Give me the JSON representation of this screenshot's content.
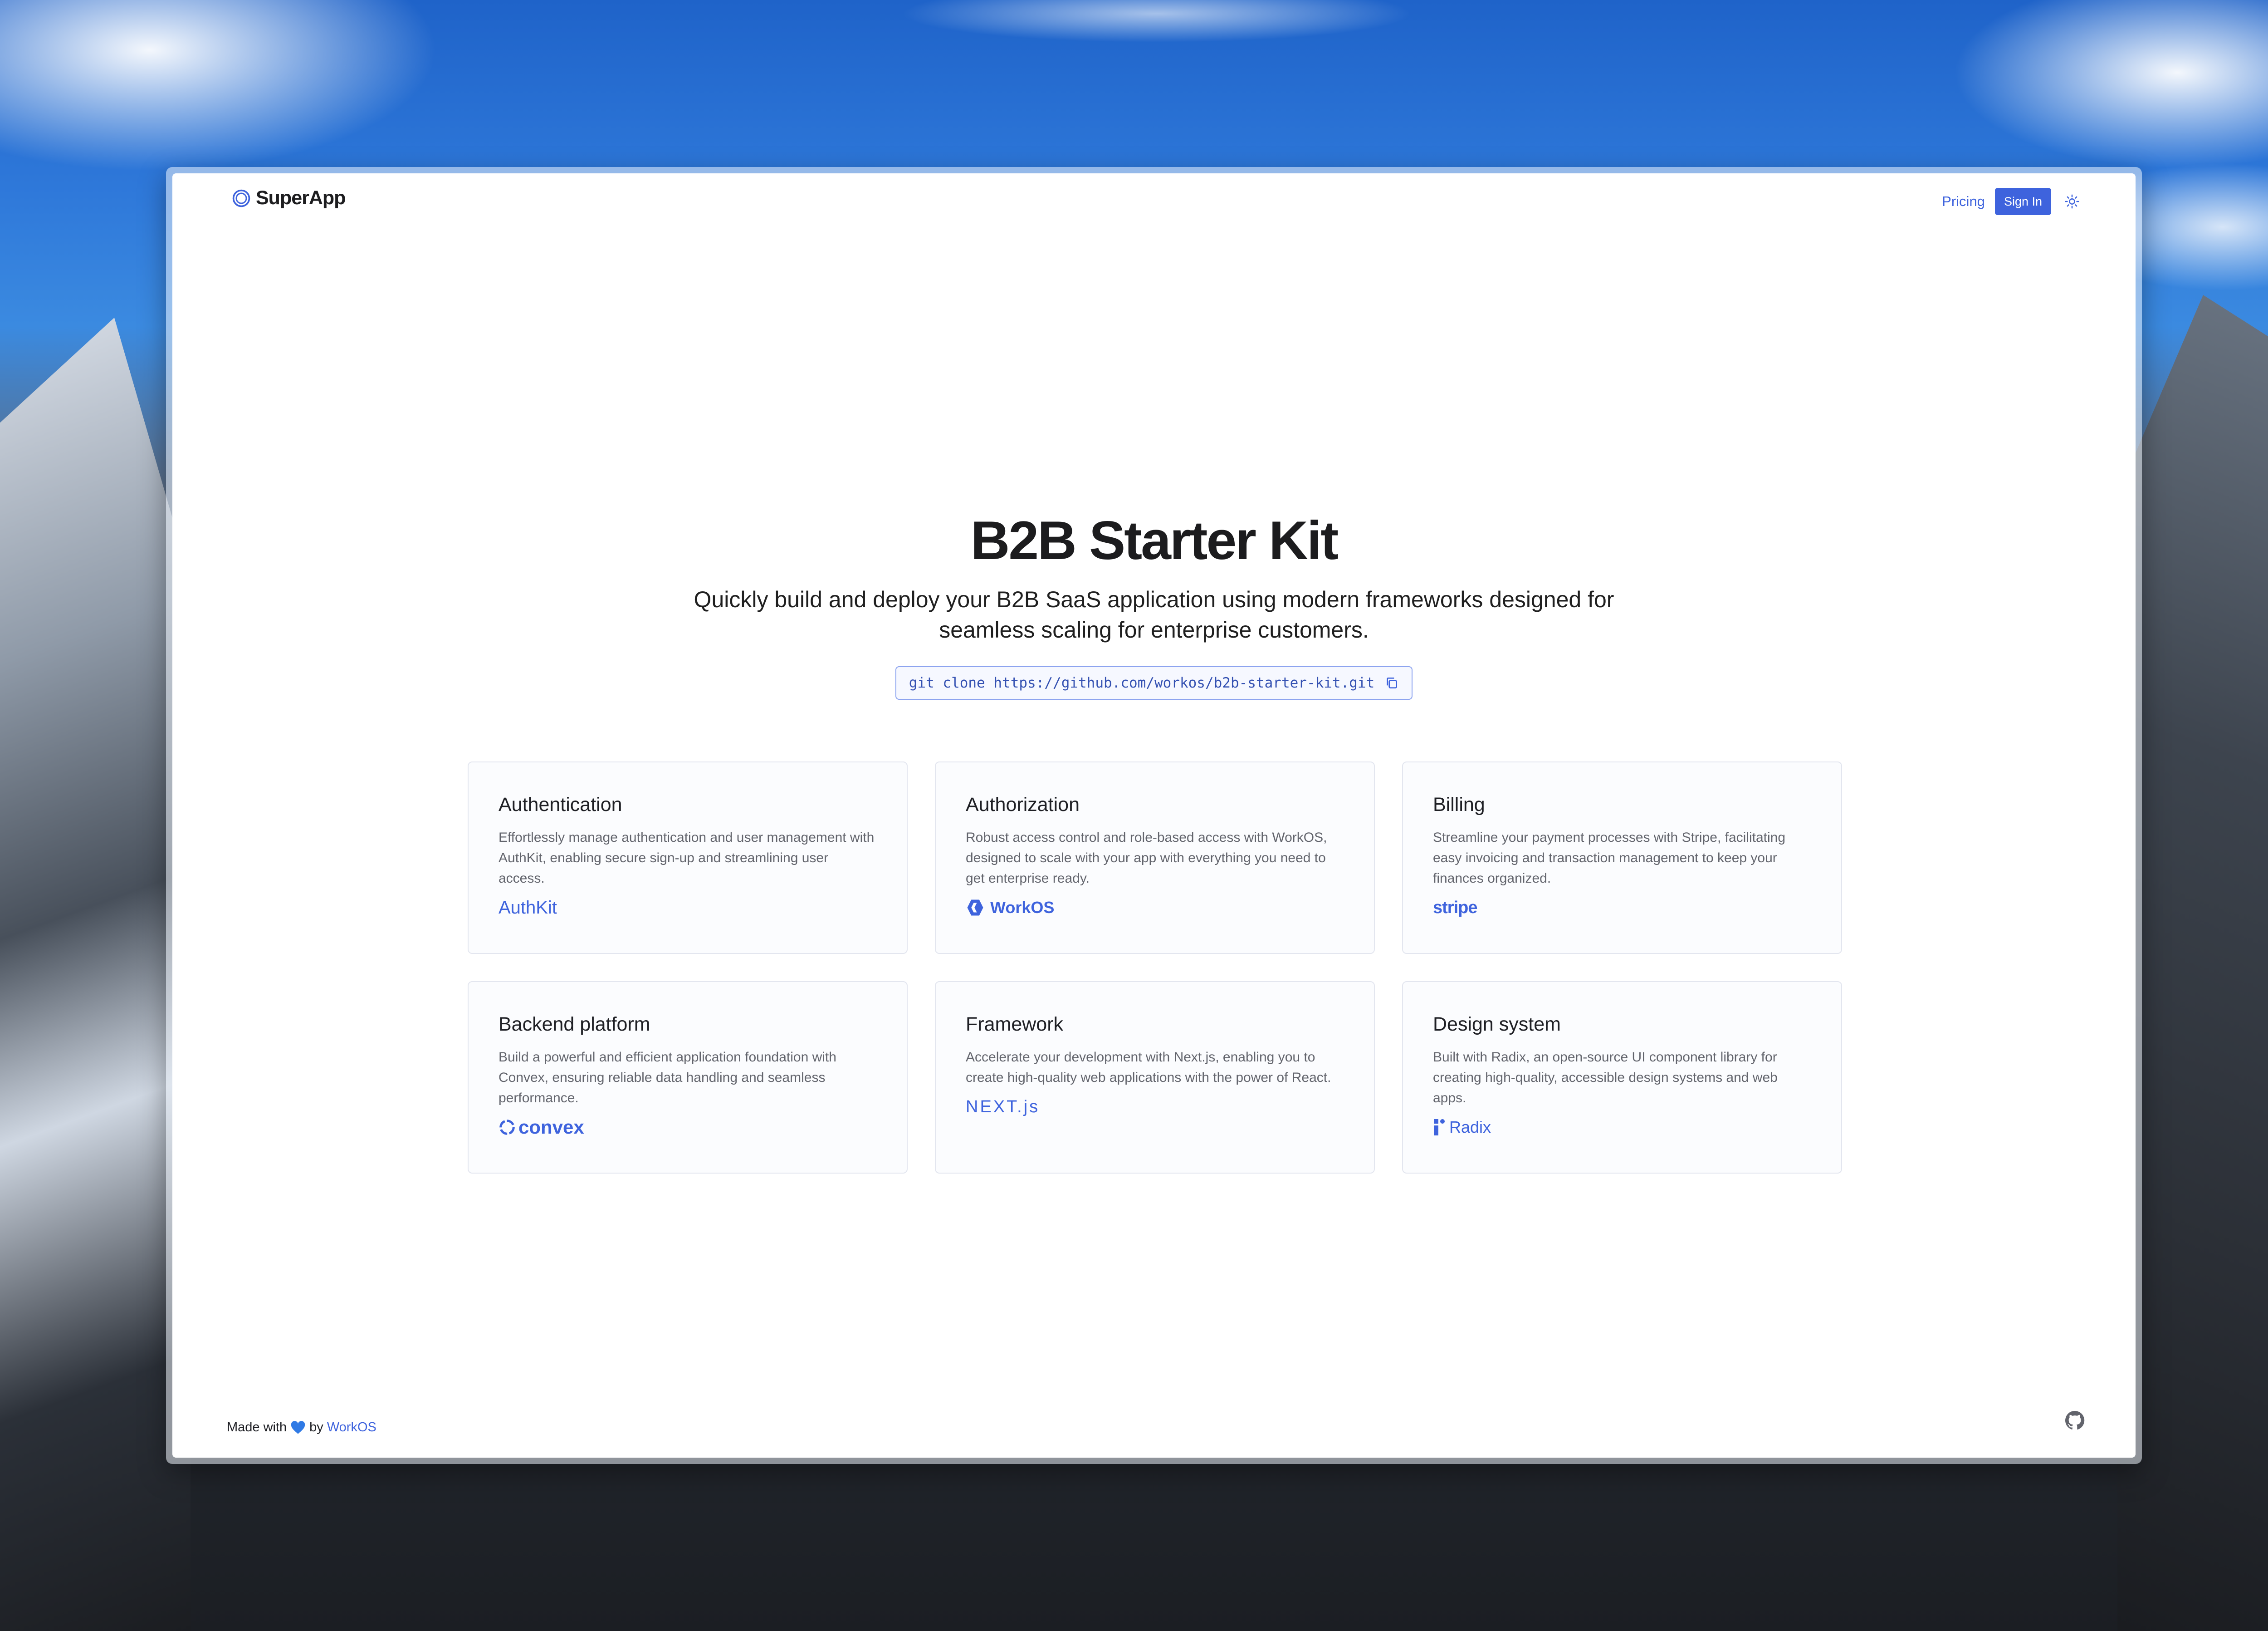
{
  "header": {
    "brand_name": "SuperApp",
    "nav_pricing": "Pricing",
    "sign_in_label": "Sign In",
    "theme_icon": "sun-icon"
  },
  "hero": {
    "title": "B2B Starter Kit",
    "subtitle": "Quickly build and deploy your B2B SaaS application using modern frameworks designed for seamless scaling for enterprise customers.",
    "clone_command": "git clone https://github.com/workos/b2b-starter-kit.git",
    "copy_icon": "copy-icon"
  },
  "cards": [
    {
      "title": "Authentication",
      "description": "Effortlessly manage authentication and user management with AuthKit, enabling secure sign-up and streamlining user access.",
      "logo": "AuthKit"
    },
    {
      "title": "Authorization",
      "description": "Robust access control and role-based access with WorkOS, designed to scale with your app with everything you need to get enterprise ready.",
      "logo": "WorkOS"
    },
    {
      "title": "Billing",
      "description": "Streamline your payment processes with Stripe, facilitating easy invoicing and transaction management to keep your finances organized.",
      "logo": "stripe"
    },
    {
      "title": "Backend platform",
      "description": "Build a powerful and efficient application foundation with Convex, ensuring reliable data handling and seamless performance.",
      "logo": "convex"
    },
    {
      "title": "Framework",
      "description": "Accelerate your development with Next.js, enabling you to create high-quality web applications with the power of React.",
      "logo": "NEXT.js"
    },
    {
      "title": "Design system",
      "description": "Built with Radix, an open-source UI component library for creating high-quality, accessible design systems and web apps.",
      "logo": "Radix"
    }
  ],
  "footer": {
    "made_with": "Made with",
    "by": "by",
    "link": "WorkOS",
    "github_icon": "github-icon"
  },
  "colors": {
    "accent": "#3e63dd",
    "text": "#1e1f24",
    "muted": "#62646c",
    "card_border": "#e3e6ef"
  }
}
